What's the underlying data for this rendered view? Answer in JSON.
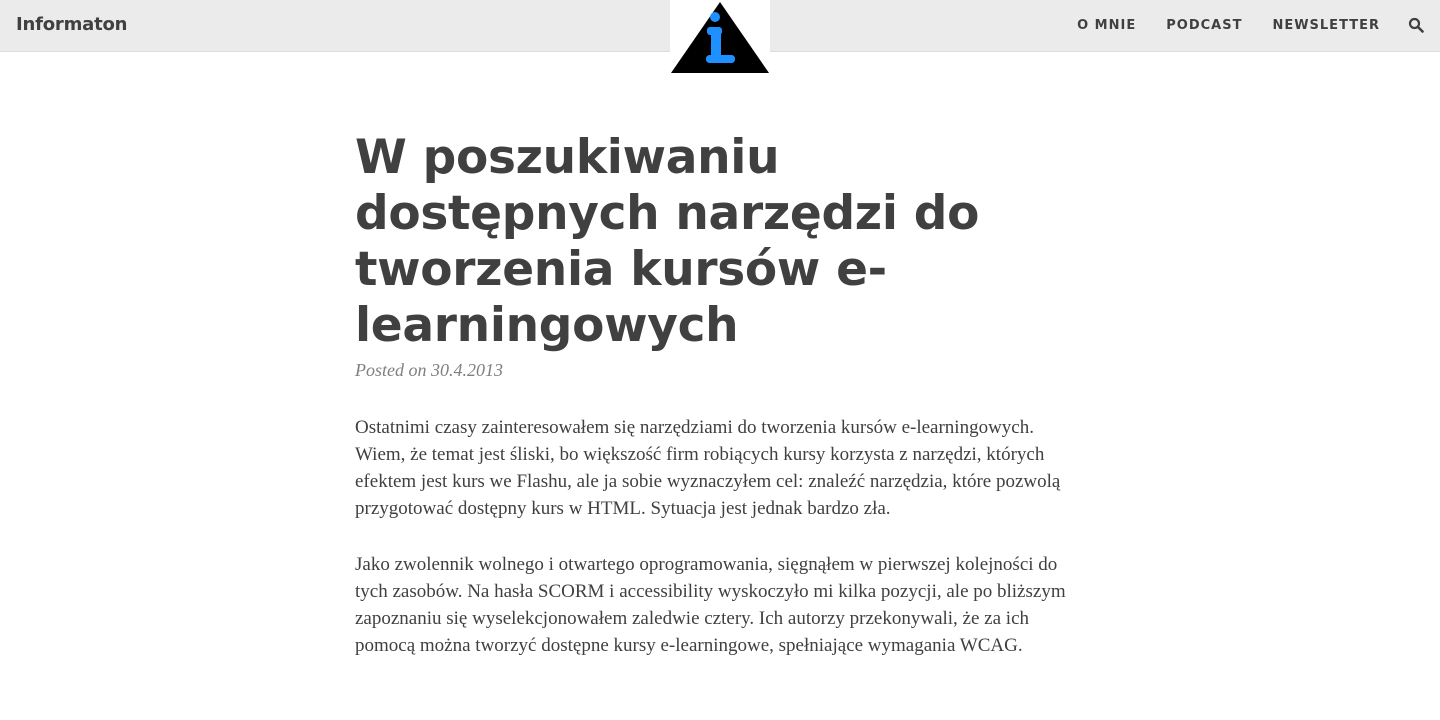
{
  "nav": {
    "brand": "Informaton",
    "links": [
      {
        "label": "O MNIE"
      },
      {
        "label": "PODCAST"
      },
      {
        "label": "NEWSLETTER"
      }
    ],
    "search_icon": "search-icon",
    "logo_icon": "info-triangle-logo"
  },
  "post": {
    "title": "W poszukiwaniu dostępnych narzędzi do tworzenia kursów e-learningowych",
    "meta": "Posted on 30.4.2013",
    "paragraphs": [
      "Ostatnimi czasy zainteresowałem się narzędziami do tworzenia kursów e-learningowych. Wiem, że temat jest śliski, bo większość firm robiących kursy korzysta z narzędzi, których efektem jest kurs we Flashu, ale ja sobie wyznaczyłem cel: znaleźć narzędzia, które pozwolą przygotować dostępny kurs w HTML. Sytuacja jest jednak bardzo zła.",
      "Jako zwolennik wolnego i otwartego oprogramowania, sięgnąłem w pierwszej kolejności do tych zasobów. Na hasła SCORM i accessibility wyskoczyło mi kilka pozycji, ale po bliższym zapoznaniu się wyselekcjonowałem zaledwie cztery. Ich autorzy przekonywali, że za ich pomocą można tworzyć dostępne kursy e-learningowe, spełniające wymagania WCAG."
    ]
  },
  "colors": {
    "nav_background": "#ebebeb",
    "text": "#404040",
    "meta_text": "#808080",
    "logo_triangle": "#000000",
    "logo_accent": "#1e90ff"
  }
}
